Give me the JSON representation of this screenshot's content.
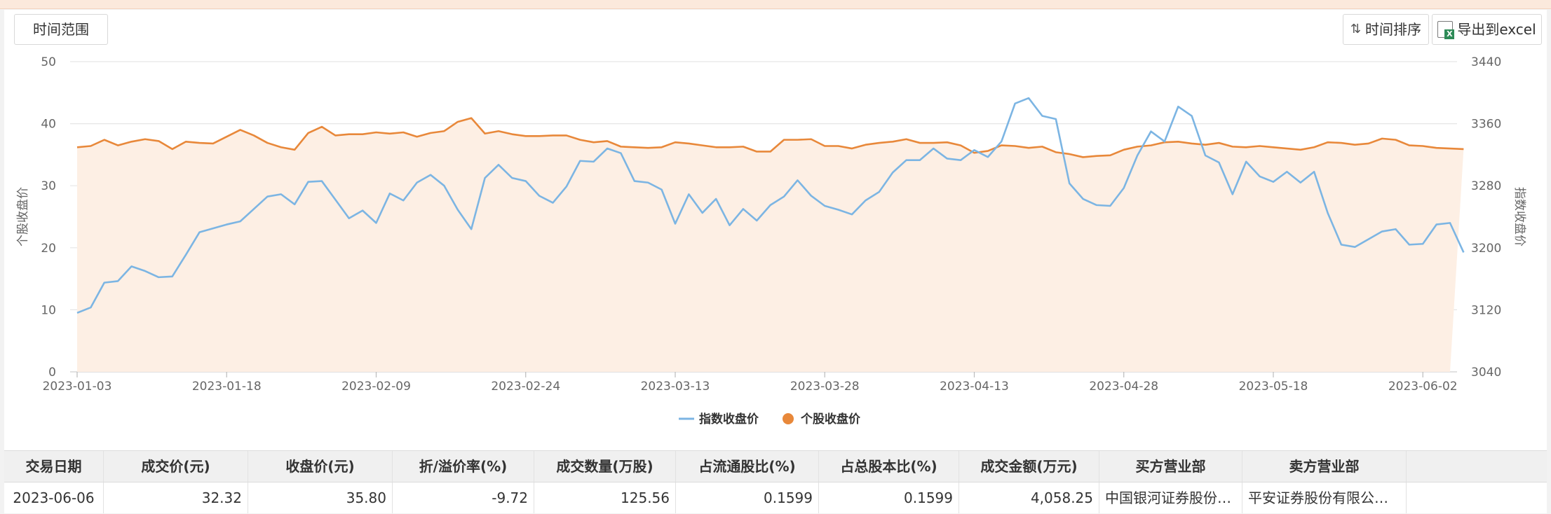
{
  "toolbar": {
    "range_label": "时间范围",
    "sort_label": "时间排序",
    "export_label": "导出到excel"
  },
  "chart_data": {
    "type": "line",
    "x": [
      "2023-01-03",
      "2023-01-04",
      "2023-01-05",
      "2023-01-06",
      "2023-01-09",
      "2023-01-10",
      "2023-01-11",
      "2023-01-12",
      "2023-01-13",
      "2023-01-16",
      "2023-01-17",
      "2023-01-18",
      "2023-01-19",
      "2023-01-20",
      "2023-01-30",
      "2023-01-31",
      "2023-02-01",
      "2023-02-02",
      "2023-02-03",
      "2023-02-06",
      "2023-02-07",
      "2023-02-08",
      "2023-02-09",
      "2023-02-10",
      "2023-02-13",
      "2023-02-14",
      "2023-02-15",
      "2023-02-16",
      "2023-02-17",
      "2023-02-20",
      "2023-02-21",
      "2023-02-22",
      "2023-02-23",
      "2023-02-24",
      "2023-02-27",
      "2023-02-28",
      "2023-03-01",
      "2023-03-02",
      "2023-03-03",
      "2023-03-06",
      "2023-03-07",
      "2023-03-08",
      "2023-03-09",
      "2023-03-10",
      "2023-03-13",
      "2023-03-14",
      "2023-03-15",
      "2023-03-16",
      "2023-03-17",
      "2023-03-20",
      "2023-03-21",
      "2023-03-22",
      "2023-03-23",
      "2023-03-24",
      "2023-03-27",
      "2023-03-28",
      "2023-03-29",
      "2023-03-30",
      "2023-03-31",
      "2023-04-03",
      "2023-04-04",
      "2023-04-06",
      "2023-04-07",
      "2023-04-10",
      "2023-04-11",
      "2023-04-12",
      "2023-04-13",
      "2023-04-14",
      "2023-04-17",
      "2023-04-18",
      "2023-04-19",
      "2023-04-20",
      "2023-04-21",
      "2023-04-24",
      "2023-04-25",
      "2023-04-26",
      "2023-04-27",
      "2023-04-28",
      "2023-05-04",
      "2023-05-05",
      "2023-05-08",
      "2023-05-09",
      "2023-05-10",
      "2023-05-11",
      "2023-05-12",
      "2023-05-15",
      "2023-05-16",
      "2023-05-17",
      "2023-05-18",
      "2023-05-19",
      "2023-05-22",
      "2023-05-23",
      "2023-05-24",
      "2023-05-25",
      "2023-05-26",
      "2023-05-29",
      "2023-05-30",
      "2023-05-31",
      "2023-06-01",
      "2023-06-02",
      "2023-06-05",
      "2023-06-06"
    ],
    "x_ticks": [
      "2023-01-03",
      "2023-01-18",
      "2023-02-09",
      "2023-02-24",
      "2023-03-13",
      "2023-03-28",
      "2023-04-13",
      "2023-04-28",
      "2023-05-18",
      "2023-06-02"
    ],
    "ylabel_left": "个股收盘价",
    "ylabel_right": "指数收盘价",
    "ylim_left": [
      0,
      50
    ],
    "yticks_left": [
      0,
      10,
      20,
      30,
      40,
      50
    ],
    "ylim_right": [
      3040,
      3440
    ],
    "yticks_right": [
      3040,
      3120,
      3200,
      3280,
      3360,
      3440
    ],
    "grid": true,
    "legend_position": "bottom-center",
    "series": [
      {
        "name": "指数收盘价",
        "axis": "right",
        "color": "#7cb5e3",
        "values": [
          3116,
          3123,
          3155,
          3157,
          3176,
          3170,
          3162,
          3163,
          3191,
          3220,
          3225,
          3230,
          3234,
          3250,
          3266,
          3269,
          3256,
          3285,
          3286,
          3262,
          3238,
          3248,
          3232,
          3270,
          3261,
          3284,
          3294,
          3280,
          3249,
          3224,
          3290,
          3307,
          3290,
          3286,
          3267,
          3258,
          3279,
          3312,
          3311,
          3328,
          3322,
          3286,
          3284,
          3275,
          3231,
          3269,
          3245,
          3263,
          3229,
          3250,
          3235,
          3255,
          3266,
          3287,
          3267,
          3254,
          3249,
          3243,
          3261,
          3272,
          3297,
          3313,
          3313,
          3328,
          3315,
          3313,
          3326,
          3317,
          3337,
          3386,
          3393,
          3370,
          3366,
          3283,
          3263,
          3255,
          3254,
          3277,
          3319,
          3350,
          3337,
          3382,
          3370,
          3319,
          3310,
          3269,
          3311,
          3292,
          3285,
          3298,
          3284,
          3298,
          3245,
          3204,
          3201,
          3211,
          3221,
          3224,
          3204,
          3205,
          3230,
          3232,
          3194
        ]
      },
      {
        "name": "个股收盘价",
        "axis": "left",
        "color": "#e8883a",
        "values": [
          36.2,
          36.4,
          37.4,
          36.5,
          37.1,
          37.5,
          37.2,
          35.9,
          37.1,
          36.9,
          36.8,
          37.9,
          39.0,
          38.1,
          36.9,
          36.2,
          35.8,
          38.5,
          39.5,
          38.1,
          38.3,
          38.3,
          38.6,
          38.4,
          38.6,
          37.9,
          38.5,
          38.8,
          40.3,
          40.9,
          38.4,
          38.8,
          38.3,
          38.0,
          38.0,
          38.1,
          38.1,
          37.4,
          37.0,
          37.2,
          36.3,
          36.2,
          36.1,
          36.2,
          37.0,
          36.8,
          36.5,
          36.2,
          36.2,
          36.3,
          35.5,
          35.5,
          37.4,
          37.4,
          37.5,
          36.4,
          36.4,
          36.0,
          36.6,
          36.9,
          37.1,
          37.5,
          36.9,
          36.9,
          37.0,
          36.5,
          35.3,
          35.6,
          36.5,
          36.4,
          36.1,
          36.3,
          35.4,
          35.1,
          34.6,
          34.8,
          34.9,
          35.8,
          36.3,
          36.5,
          37.0,
          37.1,
          36.8,
          36.6,
          36.9,
          36.3,
          36.2,
          36.4,
          36.2,
          36.0,
          35.8,
          36.2,
          37.0,
          36.9,
          36.6,
          36.8,
          37.6,
          37.4,
          36.5,
          36.4,
          36.1,
          36.0,
          35.9
        ]
      }
    ]
  },
  "table": {
    "headers": [
      "交易日期",
      "成交价(元)",
      "收盘价(元)",
      "折/溢价率(%)",
      "成交数量(万股)",
      "占流通股比(%)",
      "占总股本比(%)",
      "成交金额(万元)",
      "买方营业部",
      "卖方营业部"
    ],
    "rows": [
      [
        "2023-06-06",
        "32.32",
        "35.80",
        "-9.72",
        "125.56",
        "0.1599",
        "0.1599",
        "4,058.25",
        "中国银河证券股份有限公司中山…",
        "平安证券股份有限公司深圳深…"
      ]
    ]
  }
}
